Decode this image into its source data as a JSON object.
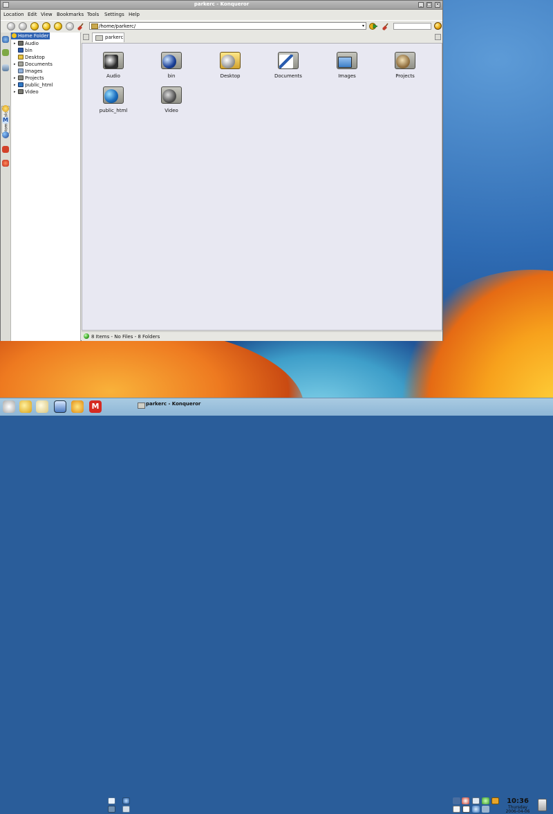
{
  "window": {
    "title": "parkerc - Konqueror"
  },
  "menu": [
    "Location",
    "Edit",
    "View",
    "Bookmarks",
    "Tools",
    "Settings",
    "Help"
  ],
  "location": {
    "value": "/home/parkerc/"
  },
  "sidebar": {
    "tab_label": "Home Folder",
    "root": "Home Folder",
    "items": [
      {
        "label": "Audio",
        "expandable": true
      },
      {
        "label": "bin",
        "expandable": false
      },
      {
        "label": "Desktop",
        "expandable": false
      },
      {
        "label": "Documents",
        "expandable": true
      },
      {
        "label": "Images",
        "expandable": false
      },
      {
        "label": "Projects",
        "expandable": true
      },
      {
        "label": "public_html",
        "expandable": true
      },
      {
        "label": "Video",
        "expandable": true
      }
    ]
  },
  "view": {
    "tab_label": "parkerc",
    "items": [
      {
        "label": "Audio",
        "icon": "folder-audio-icon"
      },
      {
        "label": "bin",
        "icon": "folder-bin-icon"
      },
      {
        "label": "Desktop",
        "icon": "folder-desktop-icon"
      },
      {
        "label": "Documents",
        "icon": "folder-documents-icon"
      },
      {
        "label": "Images",
        "icon": "folder-images-icon"
      },
      {
        "label": "Projects",
        "icon": "folder-projects-icon"
      },
      {
        "label": "public_html",
        "icon": "folder-public-html-icon"
      },
      {
        "label": "Video",
        "icon": "folder-video-icon"
      }
    ]
  },
  "status": {
    "text": "8 Items - No Files - 8 Folders"
  },
  "taskbar": {
    "task_label": "parkerc - Konqueror",
    "clock_time": "10:36",
    "clock_day": "Thursday",
    "clock_date": "2006-04-06"
  }
}
